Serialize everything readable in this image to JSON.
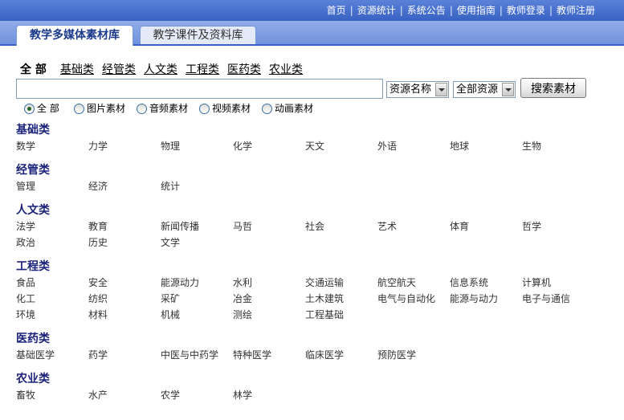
{
  "colors": {
    "brand_blue": "#3861c3",
    "tab_active_text": "#1c3a8c",
    "section_title": "#1b237a"
  },
  "top_nav": {
    "links": [
      "首页",
      "资源统计",
      "系统公告",
      "使用指南",
      "教师登录",
      "教师注册"
    ],
    "separator": "|"
  },
  "tabs": [
    {
      "label": "教学多媒体素材库",
      "active": true
    },
    {
      "label": "教学课件及资料库",
      "active": false
    }
  ],
  "category_filter": {
    "all_label": "全 部",
    "items": [
      "基础类",
      "经管类",
      "人文类",
      "工程类",
      "医药类",
      "农业类"
    ]
  },
  "search": {
    "query": "",
    "field_select": "资源名称",
    "scope_select": "全部资源",
    "dropdown_icon": "chevron-down-icon",
    "button_label": "搜索素材"
  },
  "media_types": [
    {
      "label": "全 部",
      "checked": true
    },
    {
      "label": "图片素材",
      "checked": false
    },
    {
      "label": "音频素材",
      "checked": false
    },
    {
      "label": "视频素材",
      "checked": false
    },
    {
      "label": "动画素材",
      "checked": false
    }
  ],
  "sections": [
    {
      "title": "基础类",
      "items": [
        "数学",
        "力学",
        "物理",
        "化学",
        "天文",
        "外语",
        "地球",
        "生物"
      ]
    },
    {
      "title": "经管类",
      "items": [
        "管理",
        "经济",
        "统计"
      ]
    },
    {
      "title": "人文类",
      "items": [
        "法学",
        "教育",
        "新闻传播",
        "马哲",
        "社会",
        "艺术",
        "体育",
        "哲学",
        "政治",
        "历史",
        "文学"
      ]
    },
    {
      "title": "工程类",
      "items": [
        "食品",
        "安全",
        "能源动力",
        "水利",
        "交通运输",
        "航空航天",
        "信息系统",
        "计算机",
        "化工",
        "纺织",
        "采矿",
        "冶金",
        "土木建筑",
        "电气与自动化",
        "能源与动力",
        "电子与通信",
        "环境",
        "材料",
        "机械",
        "测绘",
        "工程基础"
      ]
    },
    {
      "title": "医药类",
      "items": [
        "基础医学",
        "药学",
        "中医与中药学",
        "特种医学",
        "临床医学",
        "预防医学"
      ]
    },
    {
      "title": "农业类",
      "items": [
        "畜牧",
        "水产",
        "农学",
        "林学"
      ]
    }
  ]
}
